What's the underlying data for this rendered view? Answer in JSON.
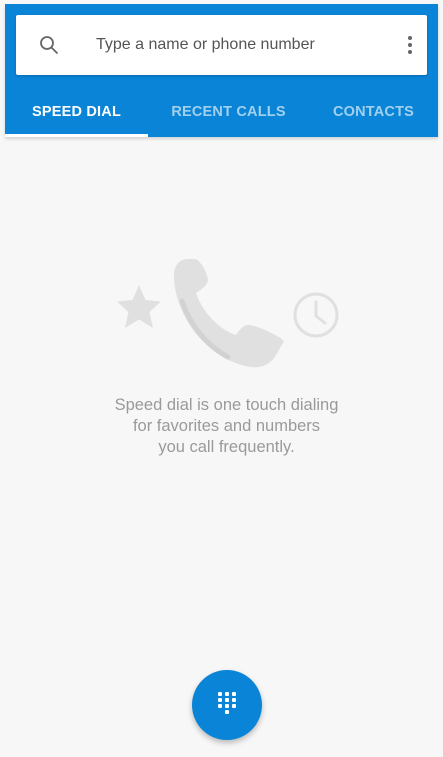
{
  "search": {
    "placeholder": "Type a name or phone number",
    "value": "",
    "icon": "search-icon",
    "menu_icon": "overflow-menu-icon"
  },
  "tabs": [
    {
      "label": "SPEED DIAL",
      "active": true
    },
    {
      "label": "RECENT CALLS",
      "active": false
    },
    {
      "label": "CONTACTS",
      "active": false
    }
  ],
  "empty_state": {
    "icons": [
      "star-icon",
      "phone-icon",
      "clock-icon"
    ],
    "lines": [
      "Speed dial is one touch dialing",
      "for favorites and numbers",
      "you call frequently."
    ]
  },
  "fab": {
    "icon": "dialpad-icon"
  },
  "colors": {
    "primary": "#0a84d6",
    "background": "#f7f7f7",
    "empty_text": "#9a9a9a",
    "illustration": "#e0e0e0"
  }
}
